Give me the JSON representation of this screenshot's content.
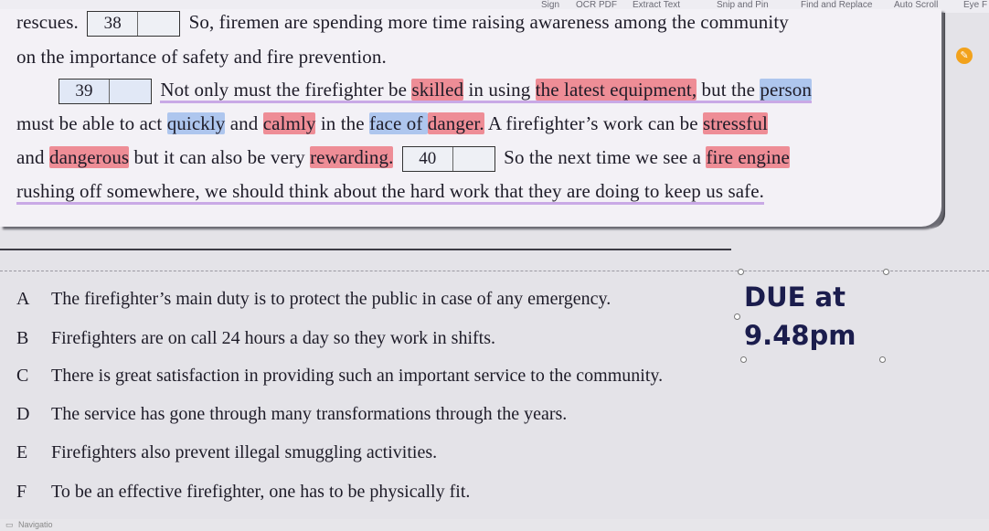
{
  "toolbar": {
    "extract_text": "Extract Text",
    "snip_and_pin": "Snip and Pin",
    "find_and_replace": "Find and Replace",
    "auto_scroll": "Auto Scroll",
    "eye": "Eye F"
  },
  "passage": {
    "line1_a": "rescues.",
    "gap38": "38",
    "line1_b": "So, firemen are spending more time raising awareness among the community",
    "line2": "on the importance of safety and fire prevention.",
    "gap39": "39",
    "line3_a": "Not only must the firefighter be ",
    "line3_b": "skilled",
    "line3_c": " in using ",
    "line3_d": "the latest equipment,",
    "line3_e": " but the ",
    "line3_f": "person",
    "line4_a": "must be able to act ",
    "line4_b": "quickly",
    "line4_c": " and ",
    "line4_d": "calmly",
    "line4_e": " in the ",
    "line4_f": "face of ",
    "line4_g": "danger.",
    "line4_h": " A firefighter’s work can be ",
    "line4_i": "stressful",
    "line5_a": "and ",
    "line5_b": "dangerous",
    "line5_c": " but it can also be very ",
    "line5_d": "rewarding.",
    "gap40": "40",
    "line5_e": "So the next time we see a ",
    "line5_f": "fire engine",
    "line6": "rushing off somewhere, we should think about the hard work that they are doing to keep us safe."
  },
  "options": [
    {
      "letter": "A",
      "text": "The firefighter’s main duty is to protect the public in case of any emergency."
    },
    {
      "letter": "B",
      "text": "Firefighters are on call 24 hours a day so they work in shifts."
    },
    {
      "letter": "C",
      "text": "There is great satisfaction in providing such an important service to the community."
    },
    {
      "letter": "D",
      "text": "The service has gone through many transformations through the years."
    },
    {
      "letter": "E",
      "text": "Firefighters also prevent illegal smuggling activities."
    },
    {
      "letter": "F",
      "text": "To be an effective firefighter, one has to be physically fit."
    }
  ],
  "annotation": {
    "line1": "DUE at",
    "line2": "9.48pm"
  },
  "footer": {
    "navigation": "Navigatio"
  }
}
